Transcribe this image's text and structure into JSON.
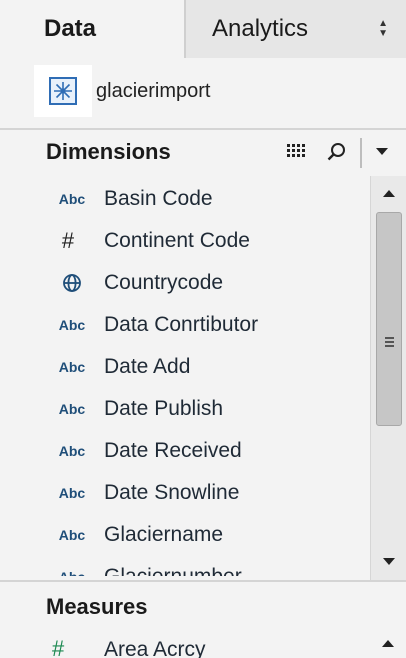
{
  "tabs": {
    "data_label": "Data",
    "analytics_label": "Analytics"
  },
  "datasource": {
    "name": "glacierimport",
    "icon": "datasource-icon"
  },
  "dimensions": {
    "title": "Dimensions",
    "type_abc": "Abc",
    "type_number": "#",
    "items": [
      {
        "type": "Abc",
        "name": "Basin Code"
      },
      {
        "type": "#",
        "name": "Continent Code"
      },
      {
        "type": "geo",
        "name": "Countrycode"
      },
      {
        "type": "Abc",
        "name": "Data Conrtibutor"
      },
      {
        "type": "Abc",
        "name": "Date Add"
      },
      {
        "type": "Abc",
        "name": "Date Publish"
      },
      {
        "type": "Abc",
        "name": "Date Received"
      },
      {
        "type": "Abc",
        "name": "Date Snowline"
      },
      {
        "type": "Abc",
        "name": "Glaciername"
      },
      {
        "type": "Abc",
        "name": "Glaciernumber"
      }
    ]
  },
  "measures": {
    "title": "Measures",
    "items": [
      {
        "type": "#",
        "name": "Area Acrcy"
      }
    ]
  },
  "colors": {
    "panel_bg": "#f3f3f3",
    "tab_inactive_bg": "#e6e6e6",
    "dimension_type": "#1f4e79",
    "measure_type": "#1d8a52"
  }
}
